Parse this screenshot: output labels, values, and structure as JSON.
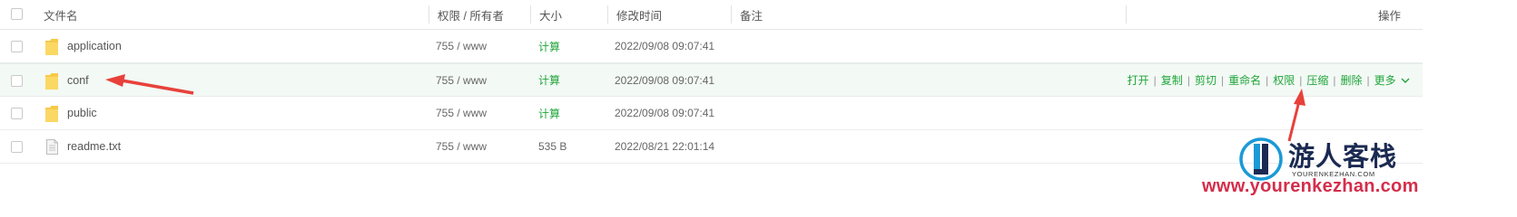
{
  "header": {
    "name": "文件名",
    "perm": "权限 / 所有者",
    "size": "大小",
    "mtime": "修改时间",
    "note": "备注",
    "ops": "操作"
  },
  "rows": [
    {
      "name": "application",
      "type": "folder",
      "perm": "755 / www",
      "size": "计算",
      "mtime": "2022/09/08 09:07:41"
    },
    {
      "name": "conf",
      "type": "folder",
      "perm": "755 / www",
      "size": "计算",
      "mtime": "2022/09/08 09:07:41"
    },
    {
      "name": "public",
      "type": "folder",
      "perm": "755 / www",
      "size": "计算",
      "mtime": "2022/09/08 09:07:41"
    },
    {
      "name": "readme.txt",
      "type": "file",
      "perm": "755 / www",
      "size": "535 B",
      "mtime": "2022/08/21 22:01:14"
    }
  ],
  "actions": {
    "open": "打开",
    "copy": "复制",
    "cut": "剪切",
    "rename": "重命名",
    "perm": "权限",
    "compress": "压缩",
    "delete": "删除",
    "more": "更多",
    "separator": "|"
  },
  "watermark": {
    "title": "游人客栈",
    "domain_small": "YOURENKEZHAN.COM",
    "url": "www.yourenkezhan.com"
  },
  "colors": {
    "accent": "#20a53a",
    "highlight_row": "#f3f9f5",
    "annotation_arrow": "#e8413b",
    "folder": "#f7c948"
  }
}
